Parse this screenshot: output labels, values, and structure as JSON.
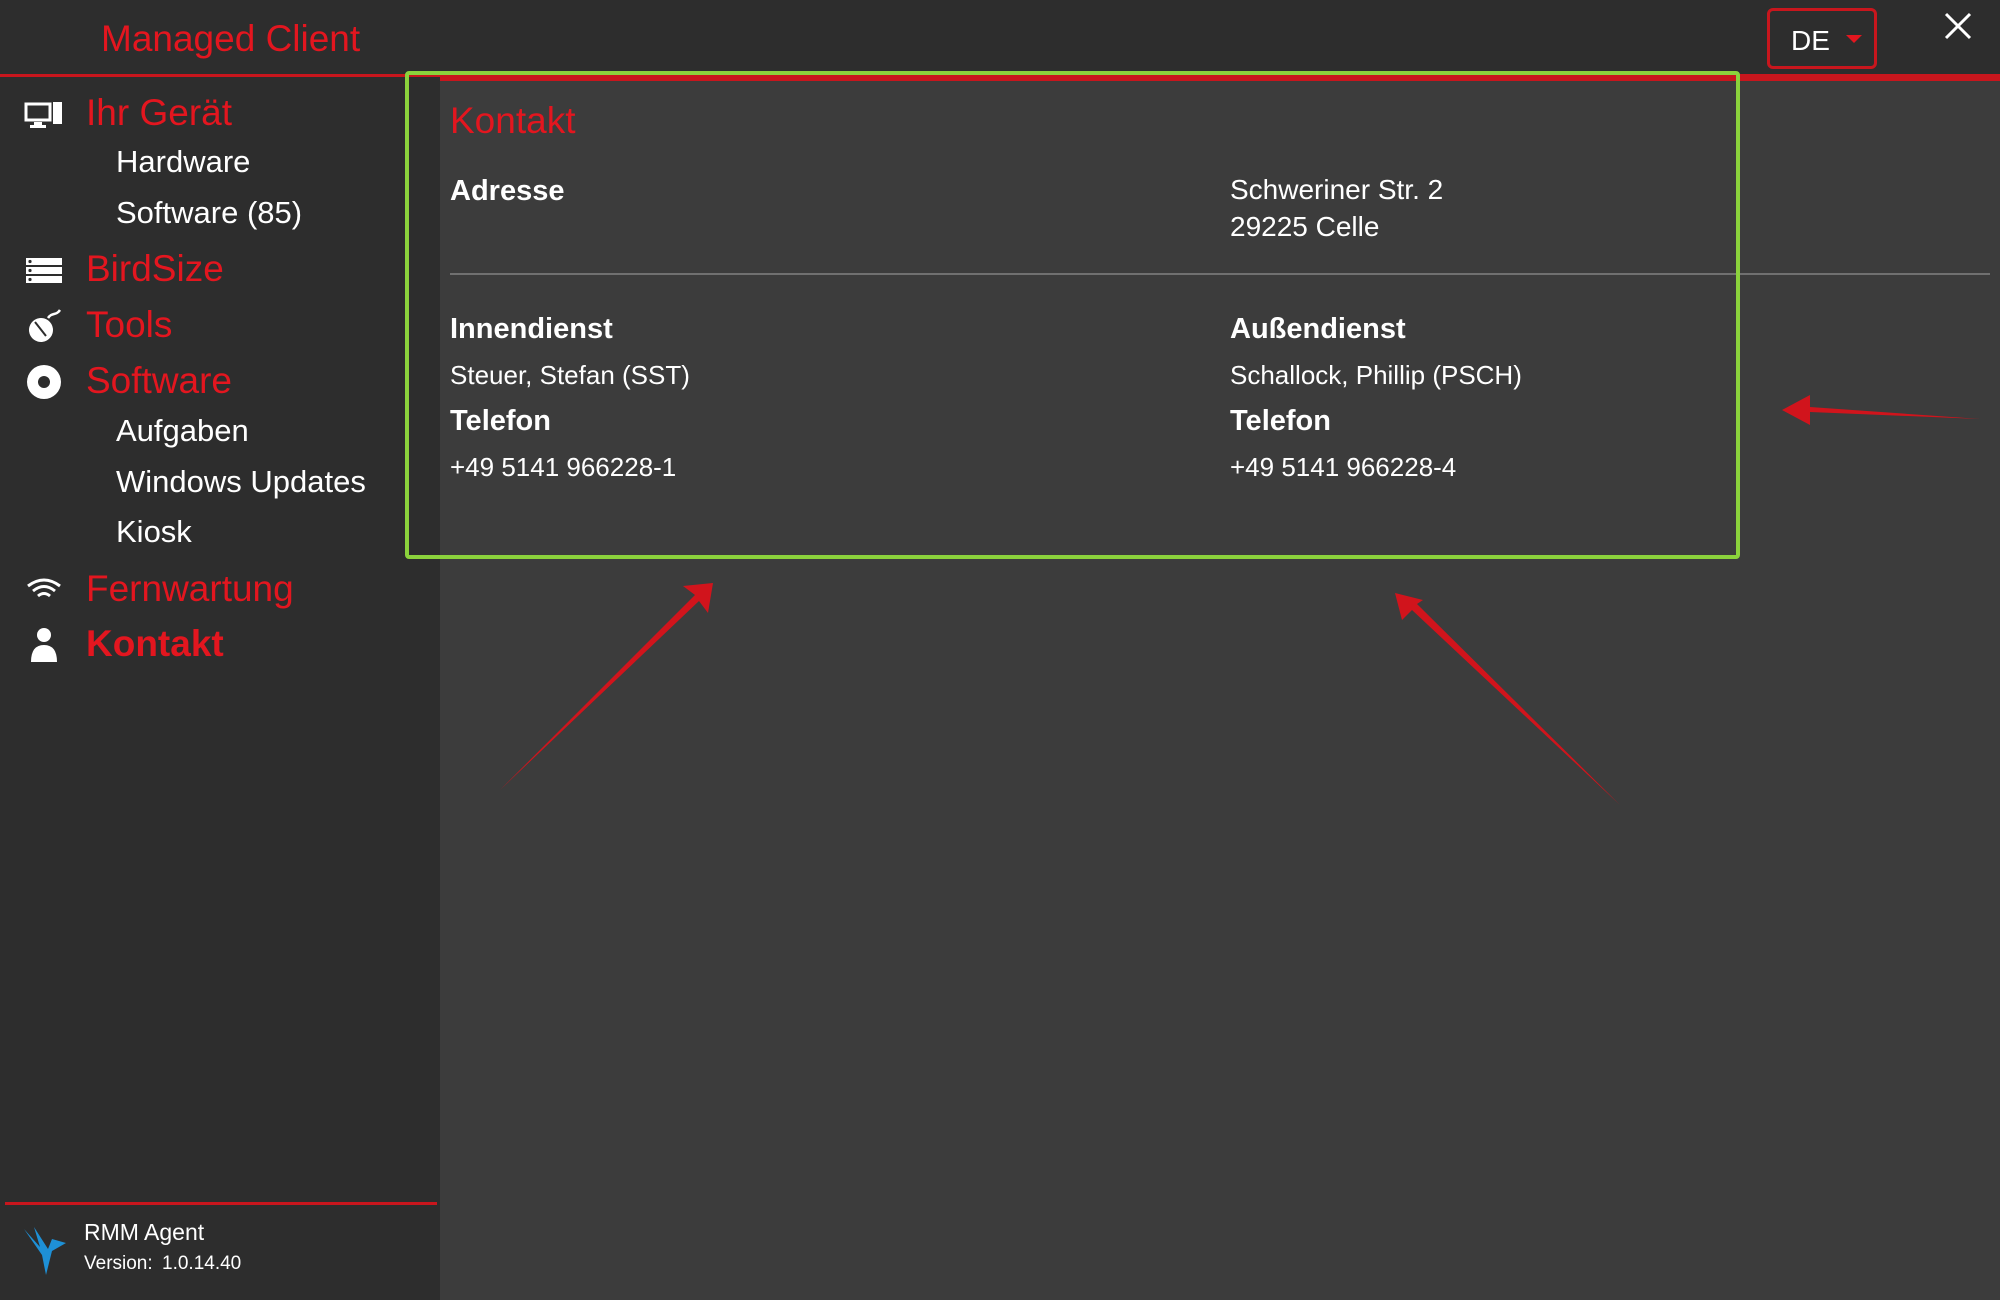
{
  "app": {
    "title": "Managed Client",
    "language": "DE"
  },
  "sidebar": {
    "items": [
      {
        "label": "Ihr Gerät",
        "icon": "monitor-icon"
      },
      {
        "label": "Hardware"
      },
      {
        "label": "Software (85)"
      },
      {
        "label": "BirdSize",
        "icon": "server-rack-icon"
      },
      {
        "label": "Tools",
        "icon": "mouse-icon"
      },
      {
        "label": "Software",
        "icon": "disc-icon"
      },
      {
        "label": "Aufgaben"
      },
      {
        "label": "Windows Updates"
      },
      {
        "label": "Kiosk"
      },
      {
        "label": "Fernwartung",
        "icon": "wifi-icon"
      },
      {
        "label": "Kontakt",
        "icon": "person-icon"
      }
    ],
    "footer": {
      "name": "RMM Agent",
      "version_label": "Version:",
      "version": "1.0.14.40"
    }
  },
  "contact": {
    "title": "Kontakt",
    "address_label": "Adresse",
    "address_line1": "Schweriner Str. 2",
    "address_line2": "29225 Celle",
    "inside": {
      "label": "Innendienst",
      "name": "Steuer, Stefan (SST)",
      "phone_label": "Telefon",
      "phone": "+49 5141 966228-1"
    },
    "outside": {
      "label": "Außendienst",
      "name": "Schallock, Phillip (PSCH)",
      "phone_label": "Telefon",
      "phone": "+49 5141 966228-4"
    }
  },
  "colors": {
    "accent": "#e3161f",
    "sidebar_bg": "#2d2d2d",
    "content_bg": "#3c3c3c",
    "highlight": "#8bd23c"
  }
}
